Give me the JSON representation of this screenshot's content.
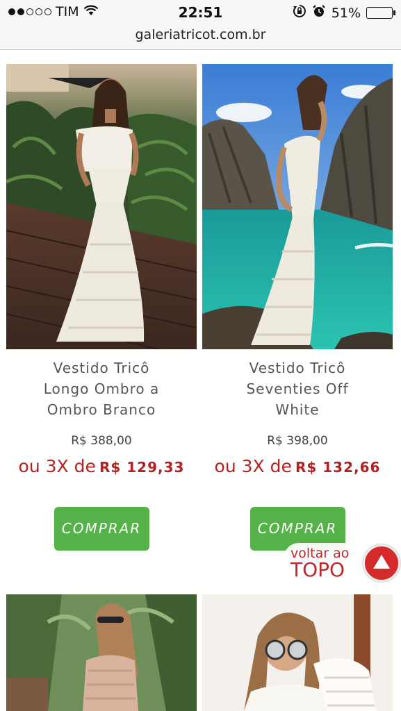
{
  "status_bar": {
    "carrier": "TIM",
    "time": "22:51",
    "battery": "51%",
    "battery_level": 0.51
  },
  "browser": {
    "url": "galeriatricot.com.br"
  },
  "products": [
    {
      "name_lines": [
        "Vestido Tricô",
        "Longo Ombro a",
        "Ombro Branco"
      ],
      "price": "R$ 388,00",
      "installment_prefix": "ou 3X de",
      "installment_value": "R$ 129,33",
      "buy_label": "COMPRAR"
    },
    {
      "name_lines": [
        "Vestido Tricô",
        "Seventies Off",
        "White"
      ],
      "price": "R$ 398,00",
      "installment_prefix": "ou 3X de",
      "installment_value": "R$ 132,66",
      "buy_label": "COMPRAR"
    }
  ],
  "back_to_top": {
    "line1": "voltar ao",
    "line2": "TOPO"
  },
  "icons": [
    "wifi-icon",
    "rotation-lock-icon",
    "alarm-icon",
    "battery-icon",
    "arrow-up-icon"
  ]
}
